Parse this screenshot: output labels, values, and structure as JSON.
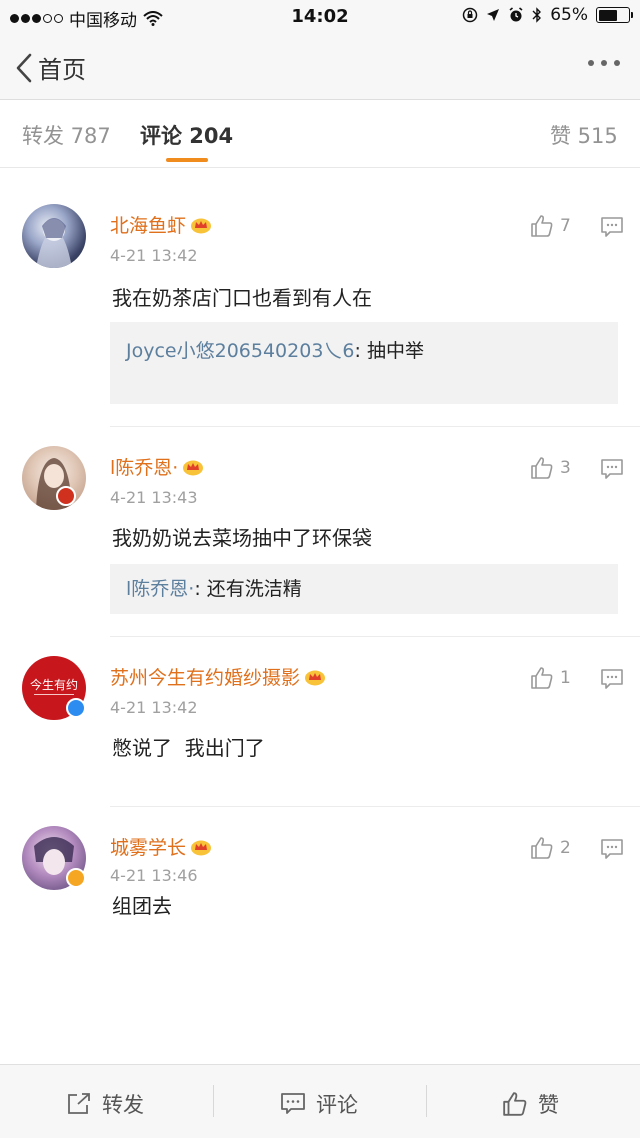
{
  "status_bar": {
    "carrier": "中国移动",
    "time": "14:02",
    "battery": "65%"
  },
  "nav": {
    "back_label": "首页"
  },
  "tabs": [
    {
      "label": "转发 787",
      "active": false
    },
    {
      "label": "评论 204",
      "active": true
    },
    {
      "label": "赞 515",
      "active": false
    }
  ],
  "comments": [
    {
      "user": "北海鱼虾",
      "time": "4-21 13:42",
      "text": "我在奶茶店门口也看到有人在",
      "likes": "7",
      "reply": {
        "name": "Joyce小悠206540203乀6",
        "sep": ":",
        "text": "抽中举"
      }
    },
    {
      "user": "l陈乔恩·",
      "time": "4-21 13:43",
      "text": "我奶奶说去菜场抽中了环保袋",
      "likes": "3",
      "reply": {
        "name": "l陈乔恩·",
        "sep": ":",
        "text": "还有洗洁精"
      }
    },
    {
      "user": "苏州今生有约婚纱摄影",
      "time": "4-21 13:42",
      "text": "憋说了  我出门了",
      "likes": "1",
      "avatar_text": "今生有约"
    },
    {
      "user": "城雾学长",
      "time": "4-21 13:46",
      "text": "组团去",
      "likes": "2"
    }
  ],
  "toolbar": {
    "repost": "转发",
    "comment": "评论",
    "like": "赞"
  },
  "colors": {
    "accent": "#f08b1e",
    "username": "#e0701c",
    "reply_name": "#5d7f9e",
    "verified_blue": "#2d8cf0",
    "verified_gold": "#f5a623",
    "vip_red": "#d0301e"
  }
}
